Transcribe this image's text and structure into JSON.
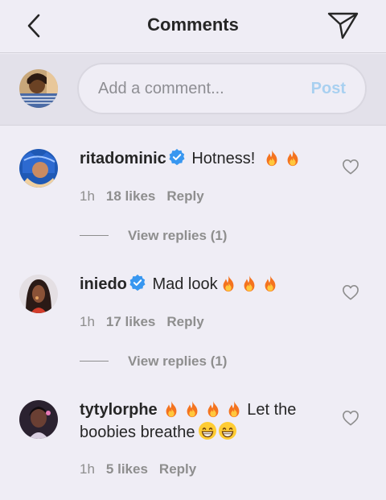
{
  "header": {
    "title": "Comments",
    "back_icon": "chevron-left-icon",
    "send_icon": "paper-plane-icon"
  },
  "composer": {
    "placeholder": "Add a comment...",
    "post_label": "Post"
  },
  "comments": [
    {
      "username": "ritadominic",
      "verified": true,
      "text": "Hotness!",
      "emojis": [
        "fire",
        "fire"
      ],
      "time": "1h",
      "likes": "18 likes",
      "reply_label": "Reply",
      "view_replies": "View replies (1)"
    },
    {
      "username": "iniedo",
      "verified": true,
      "text": "Mad look",
      "emojis": [
        "fire",
        "fire",
        "fire"
      ],
      "time": "1h",
      "likes": "17 likes",
      "reply_label": "Reply",
      "view_replies": "View replies (1)"
    },
    {
      "username": "tytylorphe",
      "verified": false,
      "text_after": "Let the boobies breathe",
      "emojis": [
        "fire",
        "fire",
        "fire",
        "fire"
      ],
      "emojis_after": [
        "grinning-face",
        "grinning-face"
      ],
      "time": "1h",
      "likes": "5 likes",
      "reply_label": "Reply"
    }
  ],
  "colors": {
    "background": "#efedf5",
    "composer_bg": "#e3e1ea",
    "post_disabled": "#a8d0f0",
    "verified_blue": "#3897f0",
    "meta_gray": "#8e8e8e"
  }
}
